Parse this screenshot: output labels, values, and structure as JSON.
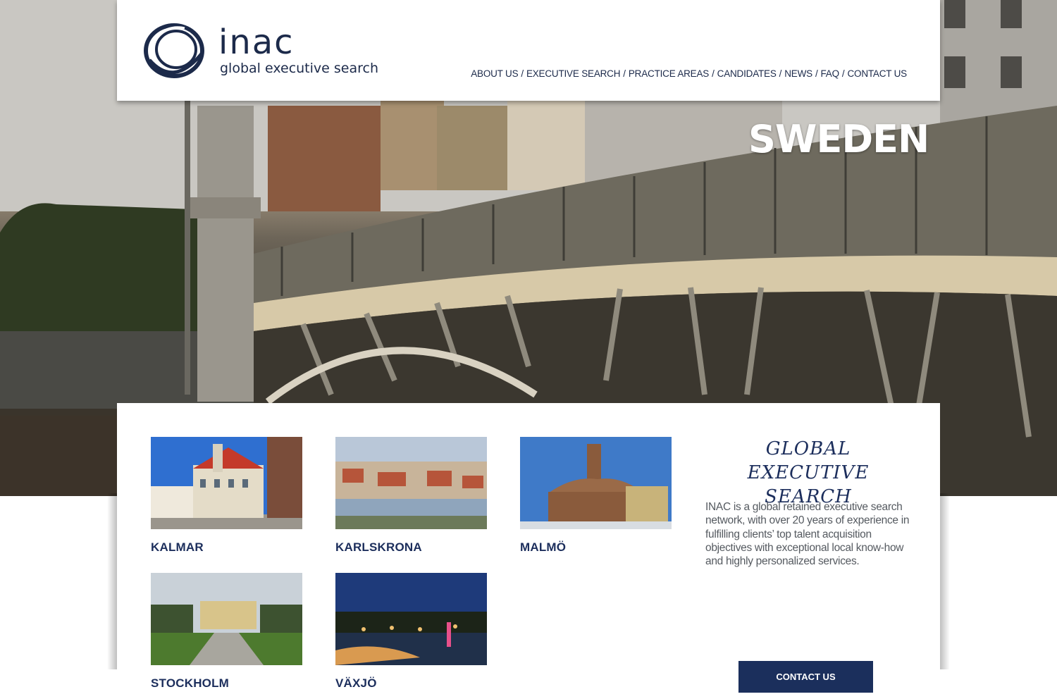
{
  "brand": {
    "name": "inac",
    "tagline": "global executive search",
    "color": "#1c2a4a"
  },
  "nav": {
    "items": [
      {
        "label": "ABOUT US"
      },
      {
        "label": "EXECUTIVE SEARCH"
      },
      {
        "label": "PRACTICE AREAS"
      },
      {
        "label": "CANDIDATES"
      },
      {
        "label": "NEWS"
      },
      {
        "label": "FAQ"
      },
      {
        "label": "CONTACT US"
      }
    ],
    "separator": "/"
  },
  "hero": {
    "title": "SWEDEN"
  },
  "cities": [
    {
      "name": "KALMAR"
    },
    {
      "name": "KARLSKRONA"
    },
    {
      "name": "MALMÖ"
    },
    {
      "name": "STOCKHOLM"
    },
    {
      "name": "VÄXJÖ"
    }
  ],
  "sidebar": {
    "heading_line1": "GLOBAL EXECUTIVE",
    "heading_line2": "SEARCH",
    "description": "INAC is a global retained executive search network, with over 20 years of experience in fulfilling clients’ top talent acquisition objectives with exceptional local know-how and highly personalized services.",
    "contact_button": "CONTACT US"
  },
  "colors": {
    "navy": "#1b2f5c",
    "text_gray": "#555a60"
  }
}
